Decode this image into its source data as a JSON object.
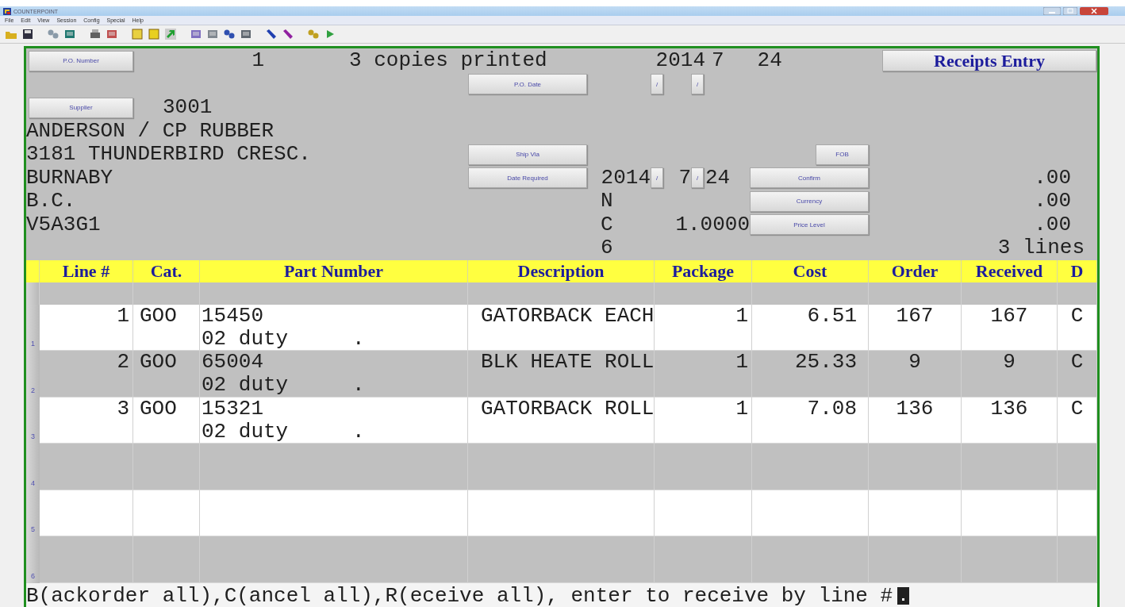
{
  "window": {
    "title": "COUNTERPOINT"
  },
  "menu": [
    "File",
    "Edit",
    "View",
    "Session",
    "Config",
    "Special",
    "Help"
  ],
  "form": {
    "po_number_button": "P.O. Number",
    "po_number": "1",
    "print_status": "3 copies printed",
    "date_year": "2014",
    "date_month": "7",
    "date_day": "24",
    "screen_title": "Receipts Entry",
    "po_date_button": "P.O. Date",
    "po_date_separators": [
      "/",
      "/"
    ],
    "supplier_button": "Supplier",
    "supplier_number": "3001",
    "supplier_address": [
      "ANDERSON / CP RUBBER",
      "3181 THUNDERBIRD CRESC.",
      "BURNABY",
      "B.C.",
      "V5A3G1"
    ],
    "ship_via_button": "Ship Via",
    "fob_button": "FOB",
    "date_required_button": "Date Required",
    "date_required": {
      "year": "2014",
      "month": "7",
      "day": "24",
      "separators": [
        "/",
        "/"
      ]
    },
    "confirm_button": "Confirm",
    "confirm": "N",
    "currency_button": "Currency",
    "currency": "C",
    "exchange_rate": "1.0000",
    "price_level_button": "Price Level",
    "price_level": "6",
    "totals": [
      ".00",
      ".00",
      ".00"
    ],
    "line_count": "3 lines"
  },
  "table": {
    "columns": [
      "Line #",
      "Cat.",
      "Part Number",
      "Description",
      "Package",
      "Cost",
      "Order",
      "Received",
      "D"
    ],
    "rows": [
      {
        "marker": "1",
        "line": "1",
        "cat": "GOO",
        "part_number": "15450",
        "part_note": "02 duty",
        "part_mark": ".",
        "description": "GATORBACK EACH",
        "package": "1",
        "cost": "6.51",
        "order": "167",
        "received": "167",
        "d": "C"
      },
      {
        "marker": "2",
        "line": "2",
        "cat": "GOO",
        "part_number": "65004",
        "part_note": "02 duty",
        "part_mark": ".",
        "description": "BLK HEATE ROLL",
        "package": "1",
        "cost": "25.33",
        "order": "9",
        "received": "9",
        "d": "C"
      },
      {
        "marker": "3",
        "line": "3",
        "cat": "GOO",
        "part_number": "15321",
        "part_note": "02 duty",
        "part_mark": ".",
        "description": "GATORBACK ROLL",
        "package": "1",
        "cost": "7.08",
        "order": "136",
        "received": "136",
        "d": "C"
      }
    ],
    "empty_markers": [
      "4",
      "5",
      "6"
    ]
  },
  "prompt": "B(ackorder all),C(ancel all),R(eceive all), enter to receive by line #"
}
